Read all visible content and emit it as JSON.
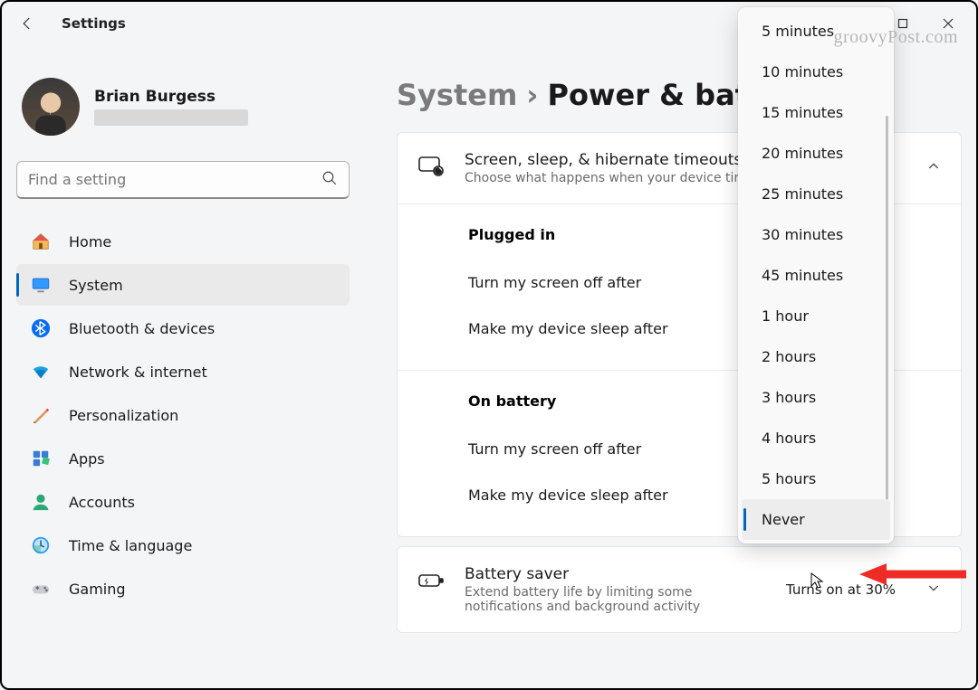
{
  "window": {
    "title": "Settings",
    "watermark": "groovyPost.com"
  },
  "user": {
    "name": "Brian Burgess"
  },
  "search": {
    "placeholder": "Find a setting"
  },
  "nav": [
    {
      "id": "home",
      "label": "Home"
    },
    {
      "id": "system",
      "label": "System",
      "selected": true
    },
    {
      "id": "bluetooth",
      "label": "Bluetooth & devices"
    },
    {
      "id": "network",
      "label": "Network & internet"
    },
    {
      "id": "personalization",
      "label": "Personalization"
    },
    {
      "id": "apps",
      "label": "Apps"
    },
    {
      "id": "accounts",
      "label": "Accounts"
    },
    {
      "id": "time",
      "label": "Time & language"
    },
    {
      "id": "gaming",
      "label": "Gaming"
    }
  ],
  "breadcrumb": {
    "parent": "System",
    "sep": "›",
    "current": "Power & bat"
  },
  "cards": {
    "sleep": {
      "title": "Screen, sleep, & hibernate timeouts",
      "subtitle": "Choose what happens when your device time",
      "sections": [
        {
          "heading": "Plugged in",
          "rows": [
            "Turn my screen off after",
            "Make my device sleep after"
          ]
        },
        {
          "heading": "On battery",
          "rows": [
            "Turn my screen off after",
            "Make my device sleep after"
          ]
        }
      ]
    },
    "saver": {
      "title": "Battery saver",
      "subtitle": "Extend battery life by limiting some notifications and background activity",
      "value": "Turns on at 30%"
    }
  },
  "dropdown": {
    "options": [
      "5 minutes",
      "10 minutes",
      "15 minutes",
      "20 minutes",
      "25 minutes",
      "30 minutes",
      "45 minutes",
      "1 hour",
      "2 hours",
      "3 hours",
      "4 hours",
      "5 hours",
      "Never"
    ],
    "selected": "Never"
  }
}
